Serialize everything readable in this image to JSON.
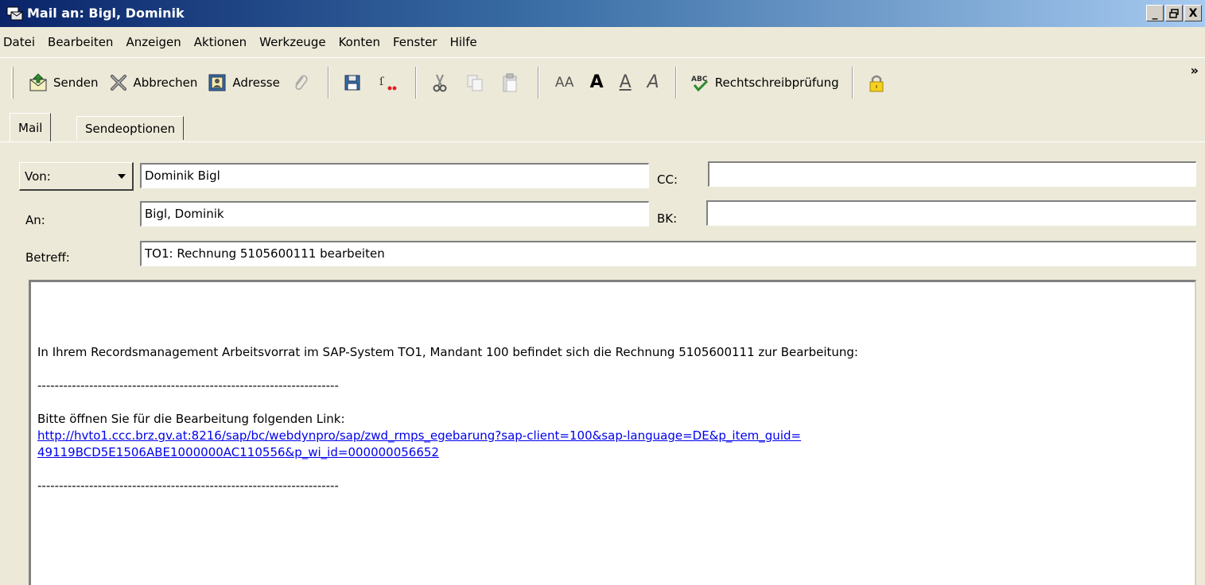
{
  "window": {
    "title": "Mail an: Bigl, Dominik",
    "buttons": [
      "_",
      "🗗",
      "X"
    ]
  },
  "menu": [
    "Datei",
    "Bearbeiten",
    "Anzeigen",
    "Aktionen",
    "Werkzeuge",
    "Konten",
    "Fenster",
    "Hilfe"
  ],
  "toolbar": {
    "send": "Senden",
    "cancel": "Abbrechen",
    "address": "Adresse",
    "spellcheck": "Rechtschreibprüfung",
    "format_small": "AA",
    "format_bold": "A",
    "format_underline": "A",
    "format_italic": "A",
    "more": "»"
  },
  "tabs": [
    {
      "label": "Mail",
      "active": true
    },
    {
      "label": "Sendeoptionen",
      "active": false
    }
  ],
  "header": {
    "from_label": "Von:",
    "from_value": "Dominik Bigl",
    "to_label": "An:",
    "to_value": "Bigl, Dominik",
    "cc_label": "CC:",
    "cc_value": "",
    "bcc_label": "BK:",
    "bcc_value": "",
    "subject_label": "Betreff:",
    "subject_value": "TO1: Rechnung 5105600111 bearbeiten"
  },
  "body": {
    "intro": "In Ihrem Recordsmanagement Arbeitsvorrat im SAP-System TO1, Mandant 100 befindet sich die Rechnung 5105600111 zur Bearbeitung:",
    "divider": "----------------------------------------------------------------------",
    "instruction": "Bitte öffnen Sie für die Bearbeitung folgenden Link:",
    "link_line1": "http://hvto1.ccc.brz.gv.at:8216/sap/bc/webdynpro/sap/zwd_rmps_egebarung?sap-client=100&sap-language=DE&p_item_guid=",
    "link_line2": "49119BCD5E1506ABE1000000AC110556&p_wi_id=000000056652",
    "divider2": "----------------------------------------------------------------------"
  }
}
